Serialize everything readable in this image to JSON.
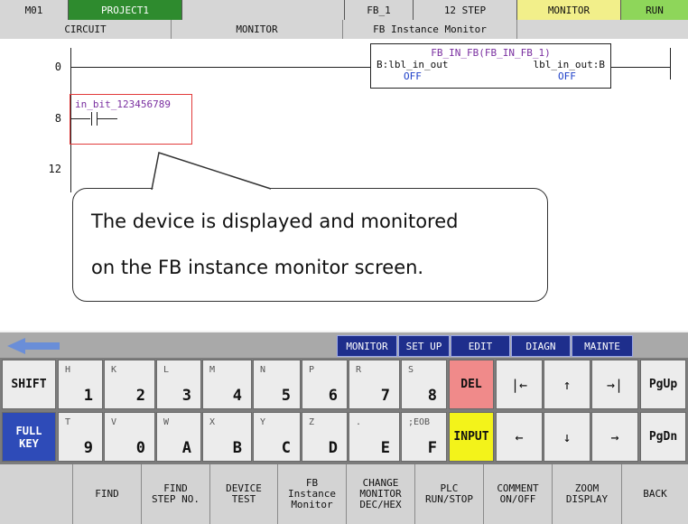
{
  "topbar": {
    "station": "M01",
    "project": "PROJECT1",
    "fb": "FB_1",
    "steps": "12 STEP",
    "mode": "MONITOR",
    "state": "RUN"
  },
  "subbar": {
    "circuit": "CIRCUIT",
    "monitor": "MONITOR",
    "fb_monitor": "FB Instance Monitor"
  },
  "ladder": {
    "steps": [
      "0",
      "8",
      "12"
    ],
    "fb_block": {
      "title": "FB_IN_FB(FB_IN_FB_1)",
      "in_label": "B:lbl_in_out",
      "out_label": "lbl_in_out:B",
      "in_value": "OFF",
      "out_value": "OFF"
    },
    "contact_label": "in_bit_123456789"
  },
  "callout": {
    "line1": "The device is displayed and monitored",
    "line2": "on the FB instance monitor screen."
  },
  "menu_tabs": [
    "MONITOR",
    "SET UP",
    "EDIT",
    "DIAGN",
    "MAINTE"
  ],
  "keys_row1": [
    {
      "small": "H",
      "big": "1"
    },
    {
      "small": "K",
      "big": "2"
    },
    {
      "small": "L",
      "big": "3"
    },
    {
      "small": "M",
      "big": "4"
    },
    {
      "small": "N",
      "big": "5"
    },
    {
      "small": "P",
      "big": "6"
    },
    {
      "small": "R",
      "big": "7"
    },
    {
      "small": "S",
      "big": "8"
    }
  ],
  "keys_row2": [
    {
      "small": "T",
      "big": "9"
    },
    {
      "small": "V",
      "big": "0"
    },
    {
      "small": "W",
      "big": "A"
    },
    {
      "small": "X",
      "big": "B"
    },
    {
      "small": "Y",
      "big": "C"
    },
    {
      "small": "Z",
      "big": "D"
    },
    {
      "small": ".",
      "big": "E"
    },
    {
      "small": ";EOB",
      "big": "F"
    }
  ],
  "special_keys": {
    "shift": "SHIFT",
    "full_key": "FULL KEY",
    "del": "DEL",
    "input": "INPUT",
    "home": "|←",
    "up": "↑",
    "end": "→|",
    "pgup": "PgUp",
    "left": "←",
    "down": "↓",
    "right": "→",
    "pgdn": "PgDn"
  },
  "function_keys": [
    "FIND",
    "FIND\nSTEP NO.",
    "DEVICE\nTEST",
    "FB\nInstance\nMonitor",
    "CHANGE\nMONITOR\nDEC/HEX",
    "PLC\nRUN/STOP",
    "COMMENT\nON/OFF",
    "ZOOM\nDISPLAY",
    "BACK"
  ],
  "colors": {
    "project_bg": "#2e8b2e",
    "mode_bg": "#f2ef8a",
    "state_bg": "#8ed65a",
    "menu_tab": "#1e2e8c",
    "del_key": "#f08a8a",
    "input_key": "#f3f31a",
    "full_key": "#2e4bb8"
  }
}
